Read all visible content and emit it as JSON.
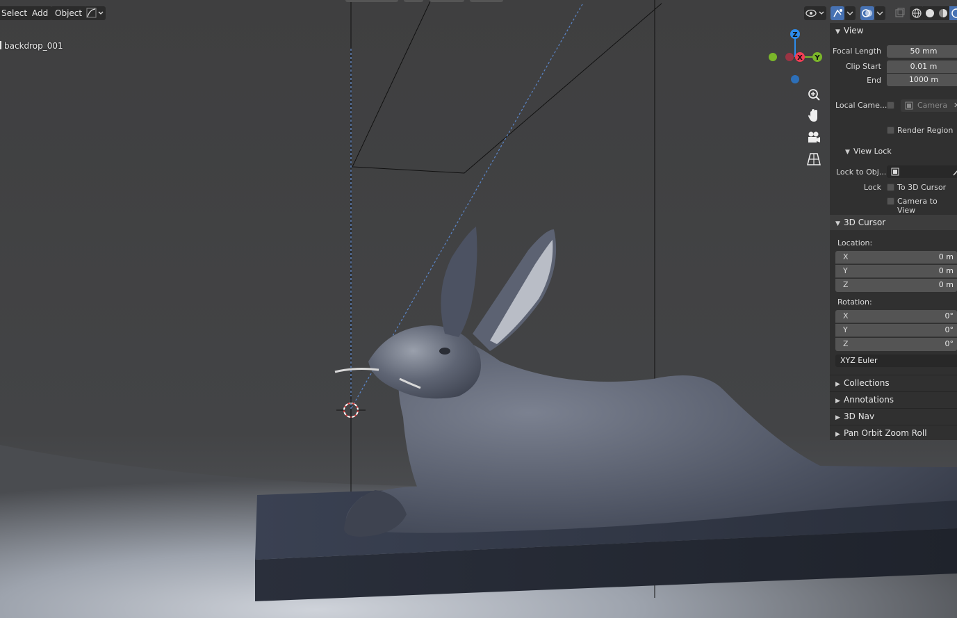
{
  "header": {
    "select_label": "Select",
    "add_label": "Add",
    "object_label": "Object"
  },
  "viewport": {
    "object_name": "backdrop_001"
  },
  "gizmo": {
    "z_label": "Z",
    "x_label": "X",
    "y_label": "Y"
  },
  "colors": {
    "accent": "#4772b3",
    "axis_x": "#f23d55",
    "axis_y": "#7bb62a",
    "axis_z": "#2d8ceb"
  },
  "sidebar": {
    "view_panel": {
      "title": "View",
      "focal_length_label": "Focal Length",
      "focal_length_value": "50 mm",
      "clip_start_label": "Clip Start",
      "clip_start_value": "0.01 m",
      "end_label": "End",
      "end_value": "1000 m",
      "local_camera_label": "Local Came...",
      "local_camera_value": "Camera",
      "render_region_label": "Render Region"
    },
    "view_lock": {
      "title": "View Lock",
      "lock_to_obj_label": "Lock to Obj...",
      "lock_label": "Lock",
      "to_3d_cursor_label": "To 3D Cursor",
      "camera_to_view_label": "Camera to View"
    },
    "cursor_panel": {
      "title": "3D Cursor",
      "location_label": "Location:",
      "location": [
        {
          "axis": "X",
          "value": "0 m"
        },
        {
          "axis": "Y",
          "value": "0 m"
        },
        {
          "axis": "Z",
          "value": "0 m"
        }
      ],
      "rotation_label": "Rotation:",
      "rotation": [
        {
          "axis": "X",
          "value": "0°"
        },
        {
          "axis": "Y",
          "value": "0°"
        },
        {
          "axis": "Z",
          "value": "0°"
        }
      ],
      "rotation_mode": "XYZ Euler"
    },
    "collapsed_panels": [
      {
        "title": "Collections"
      },
      {
        "title": "Annotations"
      },
      {
        "title": "3D Nav"
      },
      {
        "title": "Pan Orbit Zoom Roll"
      }
    ]
  }
}
